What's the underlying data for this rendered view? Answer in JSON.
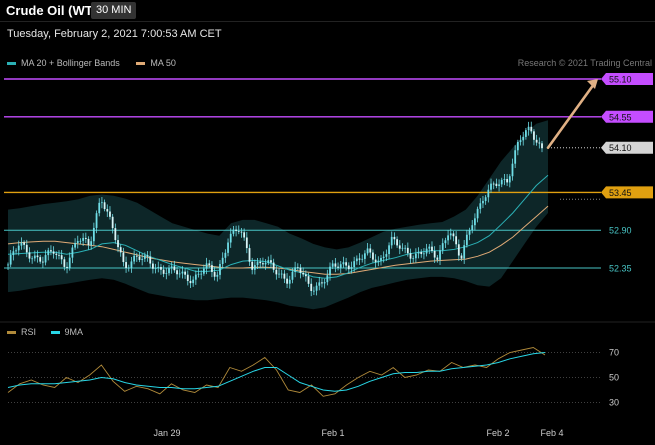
{
  "header": {
    "title": "Crude Oil (WTI)",
    "timeframe": "30 MIN",
    "datetime": "Tuesday, February 2, 2021 7:00:53 AM CET"
  },
  "credit": "Research © 2021 Trading Central",
  "legend_price": [
    {
      "name": "MA 20 + Bollinger Bands",
      "color": "#2bb0b5"
    },
    {
      "name": "MA 50",
      "color": "#e0aa76"
    }
  ],
  "legend_rsi": [
    {
      "name": "RSI",
      "color": "#b08a3a"
    },
    {
      "name": "9MA",
      "color": "#28d6e6"
    }
  ],
  "colors": {
    "resistance": "#c44dff",
    "support": "#48c4c4",
    "pivot": "#e0a010",
    "candle": "#6fdde6",
    "bollinger": "#0e2a2c",
    "arrow": "#e0b084",
    "last_price_tag": "#d4d4d4"
  },
  "chart_data": [
    {
      "type": "candlestick",
      "title": "Crude Oil (WTI) 30 MIN",
      "x_labels": [
        "Jan 29",
        "Feb 1",
        "Feb 2",
        "Feb 4"
      ],
      "ylim": [
        52.0,
        55.2
      ],
      "levels": [
        {
          "label": "55.10",
          "value": 55.1,
          "kind": "resistance",
          "tag": true
        },
        {
          "label": "54.55",
          "value": 54.55,
          "kind": "resistance",
          "tag": true
        },
        {
          "label": "54.10",
          "value": 54.1,
          "kind": "last",
          "tag": true
        },
        {
          "label": "53.45",
          "value": 53.45,
          "kind": "pivot",
          "tag": true
        },
        {
          "label": "52.90",
          "value": 52.9,
          "kind": "support",
          "tag": false
        },
        {
          "label": "52.35",
          "value": 52.35,
          "kind": "support",
          "tag": false
        }
      ],
      "close_path": [
        52.4,
        52.7,
        52.55,
        52.45,
        52.6,
        52.4,
        52.75,
        52.7,
        53.4,
        52.9,
        52.4,
        52.5,
        52.45,
        52.35,
        52.3,
        52.25,
        52.2,
        52.35,
        52.25,
        52.8,
        52.9,
        52.4,
        52.45,
        52.3,
        52.2,
        52.35,
        52.05,
        52.15,
        52.35,
        52.4,
        52.45,
        52.55,
        52.45,
        52.75,
        52.6,
        52.55,
        52.6,
        52.5,
        52.95,
        52.45,
        53.05,
        53.4,
        53.55,
        53.65,
        54.2,
        54.35,
        54.1
      ],
      "ma20_path": [
        52.55,
        52.56,
        52.57,
        52.58,
        52.58,
        52.55,
        52.58,
        52.62,
        52.7,
        52.72,
        52.68,
        52.6,
        52.52,
        52.46,
        52.4,
        52.35,
        52.3,
        52.3,
        52.32,
        52.4,
        52.45,
        52.46,
        52.44,
        52.38,
        52.32,
        52.28,
        52.22,
        52.2,
        52.22,
        52.28,
        52.36,
        52.42,
        52.46,
        52.5,
        52.55,
        52.58,
        52.6,
        52.6,
        52.62,
        52.66,
        52.72,
        52.82,
        52.98,
        53.15,
        53.35,
        53.55,
        53.7
      ],
      "bb_upper": [
        53.2,
        53.22,
        53.25,
        53.28,
        53.3,
        53.32,
        53.35,
        53.4,
        53.42,
        53.4,
        53.36,
        53.3,
        53.2,
        53.1,
        53.0,
        52.95,
        52.9,
        52.85,
        52.82,
        53.0,
        53.05,
        53.05,
        53.0,
        52.95,
        52.85,
        52.78,
        52.7,
        52.65,
        52.62,
        52.65,
        52.72,
        52.8,
        52.88,
        52.92,
        52.95,
        52.98,
        53.0,
        53.02,
        53.1,
        53.2,
        53.4,
        53.65,
        53.9,
        54.1,
        54.3,
        54.45,
        54.5
      ],
      "bb_lower": [
        52.0,
        52.02,
        52.05,
        52.08,
        52.1,
        52.12,
        52.15,
        52.18,
        52.2,
        52.18,
        52.12,
        52.05,
        51.98,
        51.95,
        51.92,
        51.9,
        51.88,
        51.88,
        51.9,
        51.92,
        51.92,
        51.9,
        51.88,
        51.85,
        51.8,
        51.78,
        51.75,
        51.78,
        51.85,
        51.92,
        52.0,
        52.06,
        52.1,
        52.14,
        52.18,
        52.2,
        52.22,
        52.22,
        52.2,
        52.16,
        52.1,
        52.08,
        52.2,
        52.45,
        52.7,
        52.95,
        53.15
      ],
      "ma50_path": [
        52.7,
        52.72,
        52.73,
        52.74,
        52.74,
        52.72,
        52.7,
        52.68,
        52.66,
        52.62,
        52.58,
        52.54,
        52.5,
        52.47,
        52.44,
        52.42,
        52.4,
        52.38,
        52.36,
        52.35,
        52.35,
        52.36,
        52.36,
        52.35,
        52.33,
        52.3,
        52.28,
        52.26,
        52.26,
        52.27,
        52.3,
        52.33,
        52.36,
        52.39,
        52.41,
        52.43,
        52.45,
        52.46,
        52.47,
        52.48,
        52.52,
        52.58,
        52.68,
        52.8,
        52.95,
        53.1,
        53.25
      ],
      "forecast_target": 55.1
    },
    {
      "type": "line",
      "title": "RSI",
      "ylim": [
        20,
        80
      ],
      "yticks": [
        "70",
        "50",
        "30"
      ],
      "series": [
        {
          "name": "RSI",
          "values": [
            38,
            45,
            48,
            44,
            42,
            50,
            46,
            52,
            60,
            47,
            39,
            43,
            41,
            37,
            45,
            40,
            38,
            44,
            42,
            58,
            55,
            60,
            66,
            56,
            40,
            38,
            44,
            35,
            37,
            44,
            50,
            55,
            52,
            58,
            50,
            52,
            56,
            55,
            62,
            58,
            60,
            58,
            65,
            70,
            72,
            74,
            68
          ]
        },
        {
          "name": "9MA",
          "values": [
            42,
            44,
            45,
            45,
            45,
            46,
            47,
            48,
            50,
            49,
            46,
            44,
            43,
            42,
            42,
            41,
            41,
            42,
            43,
            47,
            51,
            55,
            58,
            58,
            52,
            46,
            43,
            40,
            39,
            40,
            43,
            47,
            50,
            53,
            54,
            54,
            55,
            55,
            57,
            58,
            59,
            60,
            62,
            65,
            67,
            69,
            70
          ]
        }
      ]
    }
  ]
}
